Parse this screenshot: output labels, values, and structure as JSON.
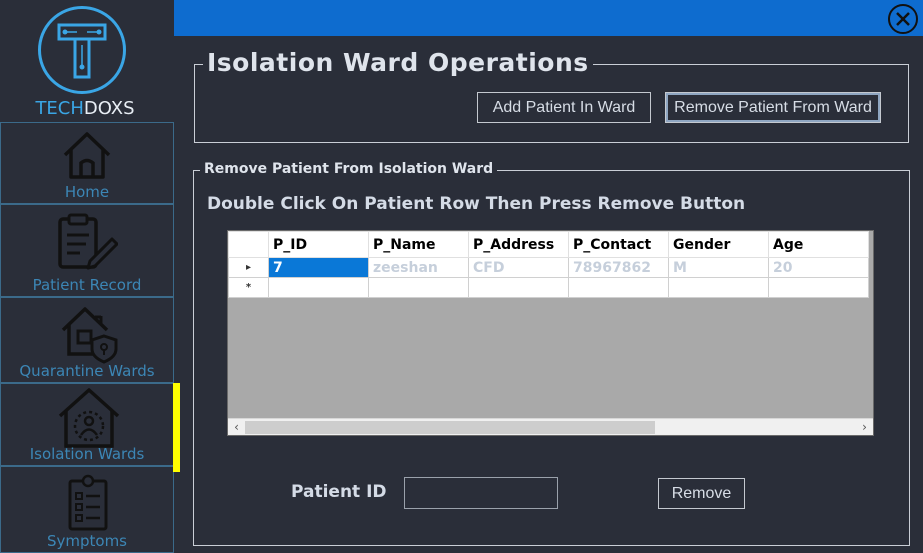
{
  "brand": {
    "prefix": "TECH",
    "suffix": "DOXS"
  },
  "sidebar": {
    "items": [
      {
        "label": "Home",
        "icon": "home-icon"
      },
      {
        "label": "Patient Record",
        "icon": "clipboard-edit-icon"
      },
      {
        "label": "Quarantine Wards",
        "icon": "house-shield-icon"
      },
      {
        "label": "Isolation Wards",
        "icon": "house-person-icon"
      },
      {
        "label": "Symptoms",
        "icon": "checklist-icon"
      }
    ],
    "active_index": 3
  },
  "operations": {
    "title": "Isolation Ward Operations",
    "add_label": "Add Patient In Ward",
    "remove_label": "Remove Patient From Ward"
  },
  "remove_panel": {
    "title": "Remove Patient From Isolation Ward",
    "instruction": "Double Click On Patient Row Then Press Remove Button",
    "columns": [
      "P_ID",
      "P_Name",
      "P_Address",
      "P_Contact",
      "Gender",
      "Age"
    ],
    "rows": [
      [
        "7",
        "zeeshan",
        "CFD",
        "78967862",
        "M",
        "20"
      ]
    ],
    "new_row_marker": "*",
    "current_row_marker": "▸",
    "patient_id_label": "Patient ID",
    "patient_id_value": "",
    "remove_button_label": "Remove"
  },
  "colors": {
    "accent": "#0e6ccf",
    "active_indicator": "#ffff00",
    "background": "#2a2e39",
    "selection": "#0a78d7"
  }
}
